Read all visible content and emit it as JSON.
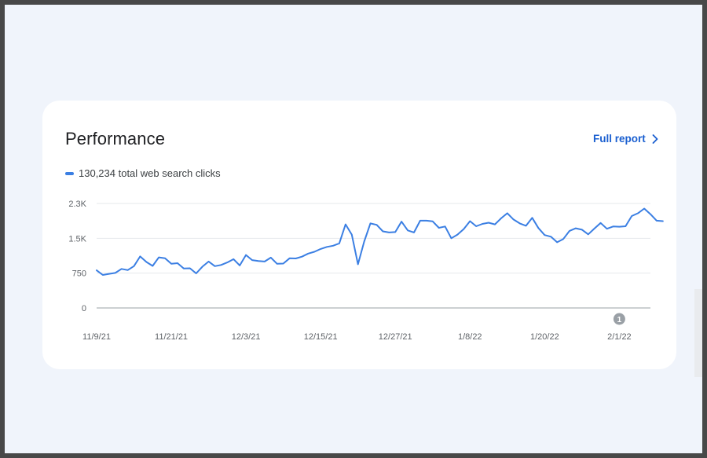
{
  "card": {
    "title": "Performance",
    "full_report_label": "Full report",
    "legend_label": "130,234 total web search clicks"
  },
  "annotation": {
    "label": "1",
    "x": "2/1/22"
  },
  "colors": {
    "line": "#3b7fe3",
    "link": "#1a5fd0",
    "annotation": "#9aa0a6"
  },
  "icons": {
    "full_report": "chevron-right-icon"
  },
  "chart_data": {
    "type": "line",
    "title": "",
    "xlabel": "",
    "ylabel": "",
    "x_tick_labels": [
      "11/9/21",
      "11/21/21",
      "12/3/21",
      "12/15/21",
      "12/27/21",
      "1/8/22",
      "1/20/22",
      "2/1/22"
    ],
    "y_tick_labels": [
      "0",
      "750",
      "1.5K",
      "2.3K"
    ],
    "y_ticks": [
      0,
      750,
      1500,
      2250
    ],
    "ylim": [
      0,
      2250
    ],
    "x_start": "11/9/21",
    "x_end": "2/6/22",
    "grid": true,
    "legend": "top-left",
    "series": [
      {
        "name": "130,234 total web search clicks",
        "values": [
          810,
          710,
          735,
          755,
          840,
          815,
          900,
          1110,
          990,
          905,
          1090,
          1070,
          950,
          965,
          850,
          855,
          745,
          890,
          1000,
          900,
          925,
          980,
          1050,
          915,
          1140,
          1030,
          1010,
          1000,
          1085,
          950,
          955,
          1070,
          1065,
          1105,
          1170,
          1210,
          1270,
          1315,
          1340,
          1390,
          1800,
          1580,
          940,
          1430,
          1820,
          1790,
          1650,
          1625,
          1635,
          1860,
          1670,
          1625,
          1880,
          1880,
          1865,
          1725,
          1755,
          1500,
          1580,
          1700,
          1870,
          1760,
          1810,
          1835,
          1800,
          1930,
          2040,
          1905,
          1820,
          1770,
          1940,
          1720,
          1570,
          1535,
          1415,
          1485,
          1660,
          1715,
          1685,
          1585,
          1710,
          1830,
          1705,
          1755,
          1750,
          1760,
          1980,
          2040,
          2140,
          2020,
          1880,
          1870
        ]
      }
    ]
  }
}
